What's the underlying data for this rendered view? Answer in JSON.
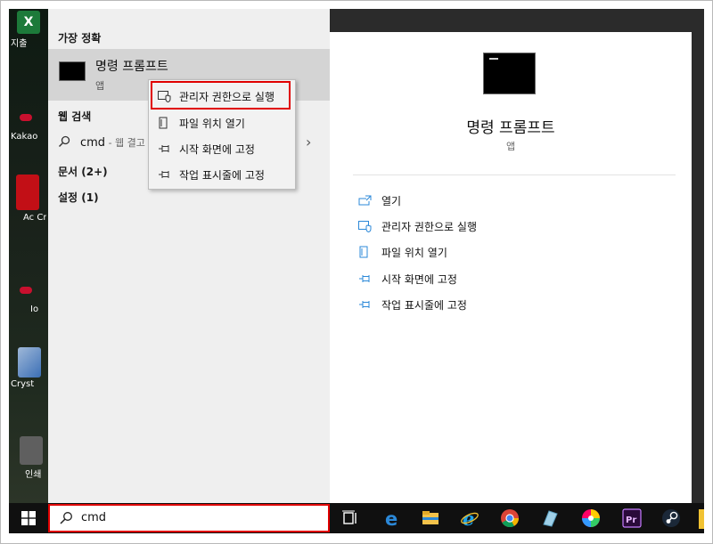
{
  "desktop": {
    "icons": [
      {
        "label": "지출",
        "color": "#1d7a3a"
      },
      {
        "label": "Kakao",
        "color": "#c8102e"
      },
      {
        "label": "Ac Cre",
        "color": "#c20f16"
      },
      {
        "label": "Io",
        "color": "#c8102e"
      },
      {
        "label": "Cryst",
        "color": "#3b6fb6"
      },
      {
        "label": "인쇄",
        "color": "#6b6b6b"
      }
    ]
  },
  "start_menu": {
    "best_match_header": "가장 정확",
    "best_match": {
      "title": "명령 프롬프트",
      "subtitle": "앱",
      "icon": "cmd-icon"
    },
    "web_search_header": "웹 검색",
    "web_search": {
      "query": "cmd",
      "suffix": " - 웹 결고"
    },
    "documents_header": "문서 (2+)",
    "settings_header": "설정 (1)",
    "context_menu": [
      {
        "label": "관리자 권한으로 실행",
        "icon": "shield-icon"
      },
      {
        "label": "파일 위치 열기",
        "icon": "file-location-icon"
      },
      {
        "label": "시작 화면에 고정",
        "icon": "pin-icon"
      },
      {
        "label": "작업 표시줄에 고정",
        "icon": "pin-icon"
      }
    ],
    "preview": {
      "title": "명령 프롬프트",
      "subtitle": "앱",
      "actions": [
        {
          "label": "열기",
          "icon": "open-icon"
        },
        {
          "label": "관리자 권한으로 실행",
          "icon": "shield-icon"
        },
        {
          "label": "파일 위치 열기",
          "icon": "file-location-icon"
        },
        {
          "label": "시작 화면에 고정",
          "icon": "pin-icon"
        },
        {
          "label": "작업 표시줄에 고정",
          "icon": "pin-icon"
        }
      ]
    }
  },
  "taskbar": {
    "search_value": "cmd",
    "accent": "#2b88d8",
    "highlight": "#e00000",
    "apps": [
      "task-view-icon",
      "edge-icon",
      "file-explorer-icon",
      "internet-explorer-icon",
      "chrome-icon",
      "app-icon",
      "color-wheel-icon",
      "premiere-icon",
      "steam-icon"
    ]
  }
}
